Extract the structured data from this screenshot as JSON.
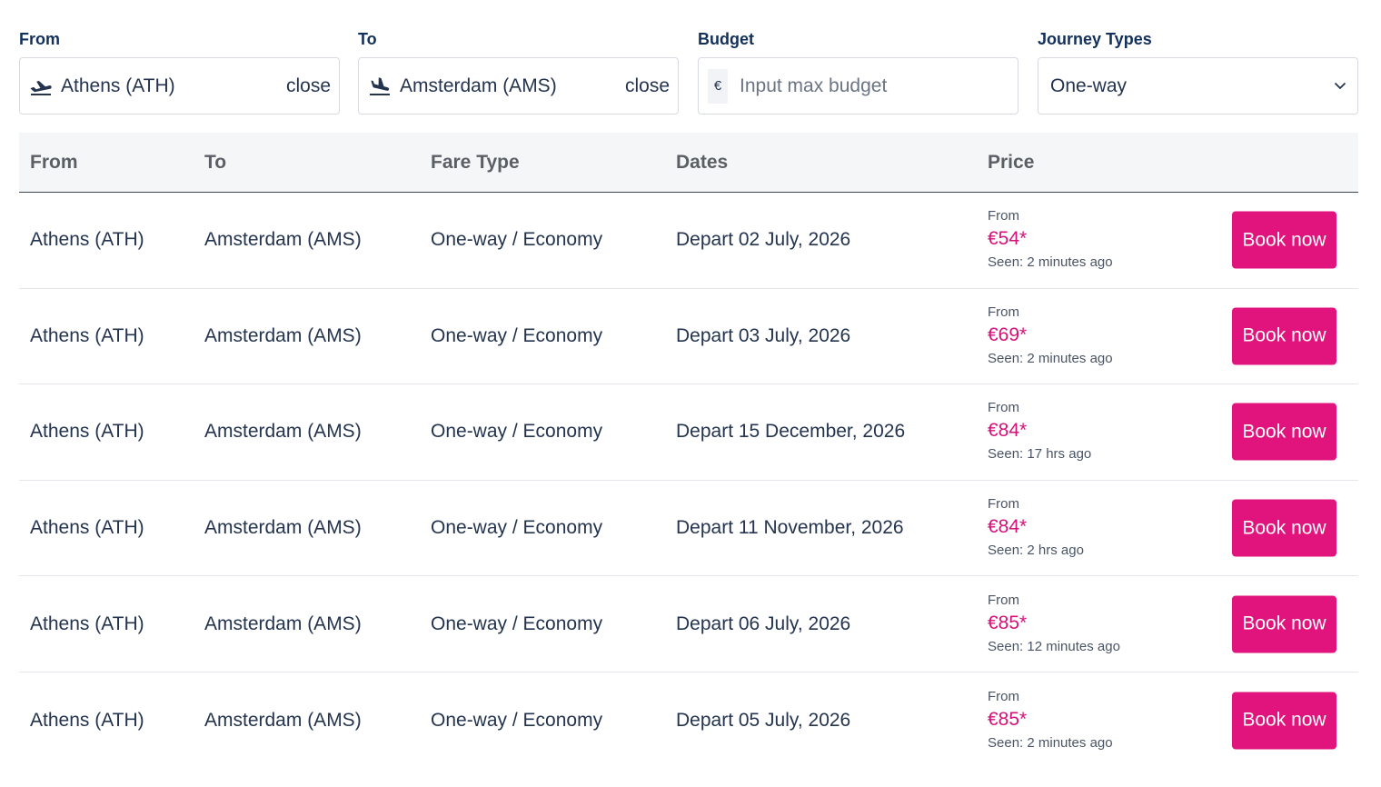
{
  "filters": {
    "from": {
      "label": "From",
      "value": "Athens (ATH)",
      "close_label": "close",
      "icon": "plane-departure-icon"
    },
    "to": {
      "label": "To",
      "value": "Amsterdam (AMS)",
      "close_label": "close",
      "icon": "plane-arrival-icon"
    },
    "budget": {
      "label": "Budget",
      "currency": "€",
      "placeholder": "Input max budget",
      "value": ""
    },
    "journey": {
      "label": "Journey Types",
      "value": "One-way",
      "icon": "chevron-down-icon"
    }
  },
  "table": {
    "headers": {
      "from": "From",
      "to": "To",
      "fare_type": "Fare Type",
      "dates": "Dates",
      "price": "Price"
    },
    "rows": [
      {
        "from": "Athens (ATH)",
        "to": "Amsterdam (AMS)",
        "fare_type": "One-way / Economy",
        "date": "Depart 02 July, 2026",
        "price_prefix": "From",
        "price": "€54*",
        "seen": "Seen: 2 minutes ago",
        "action": "Book now"
      },
      {
        "from": "Athens (ATH)",
        "to": "Amsterdam (AMS)",
        "fare_type": "One-way / Economy",
        "date": "Depart 03 July, 2026",
        "price_prefix": "From",
        "price": "€69*",
        "seen": "Seen: 2 minutes ago",
        "action": "Book now"
      },
      {
        "from": "Athens (ATH)",
        "to": "Amsterdam (AMS)",
        "fare_type": "One-way / Economy",
        "date": "Depart 15 December, 2026",
        "price_prefix": "From",
        "price": "€84*",
        "seen": "Seen: 17 hrs ago",
        "action": "Book now"
      },
      {
        "from": "Athens (ATH)",
        "to": "Amsterdam (AMS)",
        "fare_type": "One-way / Economy",
        "date": "Depart 11 November, 2026",
        "price_prefix": "From",
        "price": "€84*",
        "seen": "Seen: 2 hrs ago",
        "action": "Book now"
      },
      {
        "from": "Athens (ATH)",
        "to": "Amsterdam (AMS)",
        "fare_type": "One-way / Economy",
        "date": "Depart 06 July, 2026",
        "price_prefix": "From",
        "price": "€85*",
        "seen": "Seen: 12 minutes ago",
        "action": "Book now"
      },
      {
        "from": "Athens (ATH)",
        "to": "Amsterdam (AMS)",
        "fare_type": "One-way / Economy",
        "date": "Depart 05 July, 2026",
        "price_prefix": "From",
        "price": "€85*",
        "seen": "Seen: 2 minutes ago",
        "action": "Book now"
      }
    ]
  },
  "colors": {
    "accent": "#e0147c",
    "price": "#d4127a",
    "text": "#24344f",
    "label": "#12305a"
  }
}
